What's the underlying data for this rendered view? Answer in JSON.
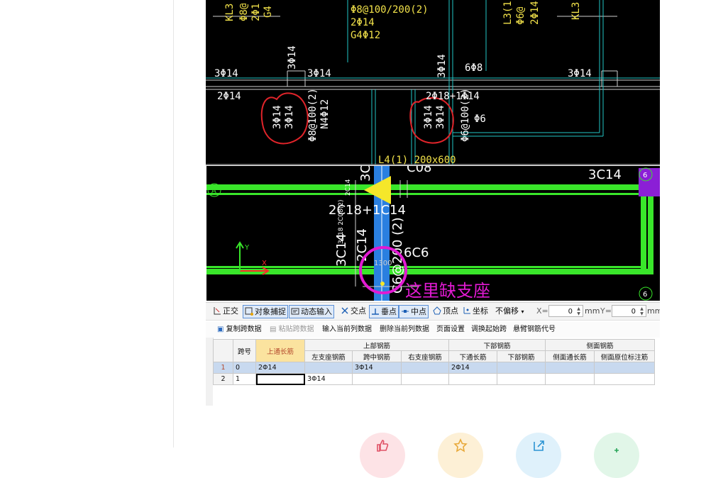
{
  "cad_top_labels": {
    "kl3_left": "KL3",
    "phi8_left": "Φ8@",
    "two_phi_left": "2Φ1",
    "g4_left": "G4",
    "beam_top": "Φ8@100/200(2)",
    "two_phi14": "2Φ14",
    "g4_phi12": "G4Φ12",
    "l3_label": "L3(1",
    "phi6_label": "Φ6@",
    "two_phi14_vert": "2Φ14",
    "kl3_right": "KL3",
    "r_3phi14_a": "3Φ14",
    "r_3phi14_vert": "3Φ14",
    "r_3phi14_b": "3Φ14",
    "r_3phi14_vert2": "3Φ14",
    "r_6phi8": "6Φ8",
    "r_3phi14_c": "3Φ14",
    "r_2phi14": "2Φ14",
    "r_2phi18": "2Φ18+1Φ14",
    "circ1_a": "3Φ14",
    "circ1_b": "3Φ14",
    "phi8_100": "Φ8@100(2)",
    "n4_phi12": "N4Φ12",
    "circ2_a": "3Φ14",
    "circ2_b": "3Φ14",
    "circ2_c": "3Φ14",
    "phi6_100": "Φ6@100(2)",
    "phi6": "Φ6",
    "l4_label": "L4(1) 200x600"
  },
  "cad_main_labels": {
    "axis_a": "A",
    "axis_6_top": "6",
    "axis_6_bottom": "6",
    "t_3c14": "3C14",
    "t_3c": "3C",
    "t_c08": "C08",
    "t_2c18": "2C18+1C14",
    "t_side1": "2C14",
    "t_side2": "3C18 2C08(2)",
    "t_3c14_v": "3C14",
    "t_3c14_v2": "2C14",
    "t_6c6": "6C6",
    "t_c6": "C6@200 (2)",
    "t_1300": "1300",
    "axis_y": "Y",
    "axis_x": "X",
    "annotation": "这里缺支座"
  },
  "toolbar": {
    "ortho": "正交",
    "snap": "对象捕捉",
    "dyn_input": "动态输入",
    "intersection": "交点",
    "perpendicular": "垂点",
    "midpoint": "中点",
    "vertex": "顶点",
    "coordinate": "坐标",
    "offset_mode": "不偏移",
    "x_label": "X=",
    "x_value": "0",
    "x_unit": "mm",
    "y_label": "Y=",
    "y_value": "0",
    "y_unit": "mm"
  },
  "grid_toolbar": {
    "copy_span": "复制跨数据",
    "paste_span": "粘贴跨数据",
    "input_col": "输入当前列数据",
    "delete_col": "删除当前列数据",
    "page_setup": "页面设置",
    "adjust_start": "调换起始跨",
    "cantilever": "悬臂钢筋代号"
  },
  "grid": {
    "headers": {
      "span_no": "跨号",
      "top_through": "上通长筋",
      "top_group": "上部钢筋",
      "left_support": "左支座钢筋",
      "mid_span": "跨中钢筋",
      "right_support": "右支座钢筋",
      "bottom_group": "下部钢筋",
      "bottom_through": "下通长筋",
      "bottom_bar": "下部钢筋",
      "side_group": "侧面钢筋",
      "side_through": "侧面通长筋",
      "side_original": "侧面原位标注筋"
    },
    "rows": [
      {
        "n": "1",
        "span": "0",
        "top_through": "2Φ14",
        "left": "",
        "mid": "3Φ14",
        "right": "",
        "bottom_through": "2Φ14",
        "bottom": "",
        "side_through": "",
        "side_orig": ""
      },
      {
        "n": "2",
        "span": "1",
        "top_through": "",
        "left": "3Φ14",
        "mid": "",
        "right": "",
        "bottom_through": "",
        "bottom": "",
        "side_through": "",
        "side_orig": ""
      }
    ]
  },
  "actions": {
    "like_icon": "thumb-up-icon",
    "star_icon": "star-icon",
    "share_icon": "share-icon",
    "plus_icon": "plus-icon"
  }
}
